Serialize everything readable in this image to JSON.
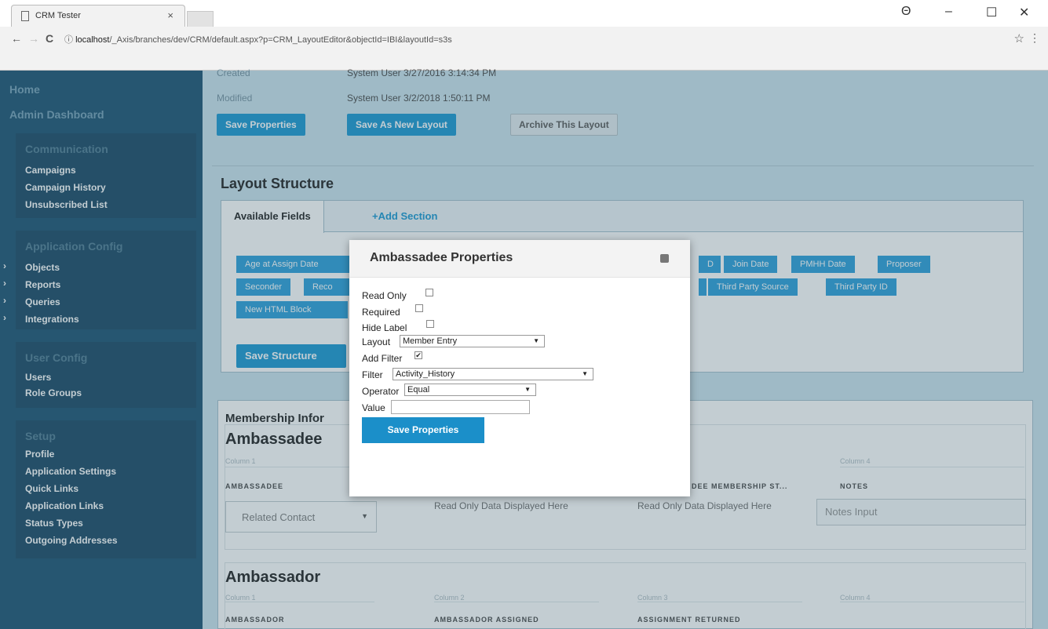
{
  "browser": {
    "tab_title": "CRM Tester",
    "tab_close": "×",
    "url_host": "localhost",
    "url_path": "/_Axis/branches/dev/CRM/default.aspx?p=CRM_LayoutEditor&objectId=IBI&layoutId=s3s",
    "account_icon": "Θ",
    "minimize": "–",
    "maximize": "☐",
    "close": "✕",
    "back": "←",
    "forward": "→",
    "reload": "C",
    "info": "ⓘ",
    "star": "☆",
    "menu": "⋮"
  },
  "sidebar": {
    "home": "Home",
    "admin_dashboard": "Admin Dashboard",
    "communication": {
      "heading": "Communication",
      "links": [
        "Campaigns",
        "Campaign History",
        "Unsubscribed List"
      ]
    },
    "app_config": {
      "heading": "Application Config",
      "links": [
        "Objects",
        "Reports",
        "Queries",
        "Integrations"
      ]
    },
    "user_config": {
      "heading": "User Config",
      "links": [
        "Users",
        "Role Groups"
      ]
    },
    "setup": {
      "heading": "Setup",
      "links": [
        "Profile",
        "Application Settings",
        "Quick Links",
        "Application Links",
        "Status Types",
        "Outgoing Addresses"
      ]
    }
  },
  "meta": {
    "created_label": "Created",
    "created_value": "System User 3/27/2016 3:14:34 PM",
    "modified_label": "Modified",
    "modified_value": "System User 3/2/2018 1:50:11 PM"
  },
  "toolbar": {
    "save_properties": "Save Properties",
    "save_as_new_layout": "Save As New Layout",
    "archive_layout": "Archive This Layout"
  },
  "structure": {
    "title": "Layout Structure",
    "tab_available": "Available Fields",
    "tab_add_section": "+Add Section",
    "chips_row1": [
      "Age at Assign Date",
      "D",
      "Join Date",
      "PMHH Date",
      "Proposer"
    ],
    "chips_row2": [
      "Seconder",
      "Reco",
      "Third Party Source",
      "Third Party ID"
    ],
    "chips_row3": [
      "New HTML Block"
    ],
    "save_structure": "Save Structure"
  },
  "membership": {
    "panel_title": "Membership Infor",
    "section1": {
      "title": "Ambassadee",
      "col1_hint": "Column 1",
      "col4_hint": "Column 4",
      "col1_head": "AMBASSADEE",
      "col3_head": "DEE MEMBERSHIP ST...",
      "col4_head": "NOTES",
      "col2_text": "Read Only Data Displayed Here",
      "col3_text": "Read Only Data Displayed Here",
      "related_contact": "Related Contact",
      "notes_placeholder": "Notes Input"
    },
    "section2": {
      "title": "Ambassador",
      "col1_hint": "Column 1",
      "col2_hint": "Column 2",
      "col3_hint": "Column 3",
      "col4_hint": "Column 4",
      "col1_head": "AMBASSADOR",
      "col2_head": "AMBASSADOR ASSIGNED",
      "col3_head": "ASSIGNMENT RETURNED"
    }
  },
  "modal": {
    "title": "Ambassadee Properties",
    "read_only": "Read Only",
    "required": "Required",
    "hide_label": "Hide Label",
    "layout_label": "Layout",
    "layout_value": "Member Entry",
    "add_filter": "Add Filter",
    "filter_label": "Filter",
    "filter_value": "Activity_History",
    "operator_label": "Operator",
    "operator_value": "Equal",
    "value_label": "Value",
    "save": "Save Properties",
    "read_only_checked": false,
    "required_checked": false,
    "hide_label_checked": false,
    "add_filter_checked": true
  },
  "colors": {
    "sidebar_bg": "#2c5f7c",
    "accent": "#2a9fd6",
    "chip": "#3aa7dd",
    "page_bg": "#cfe6ef"
  }
}
